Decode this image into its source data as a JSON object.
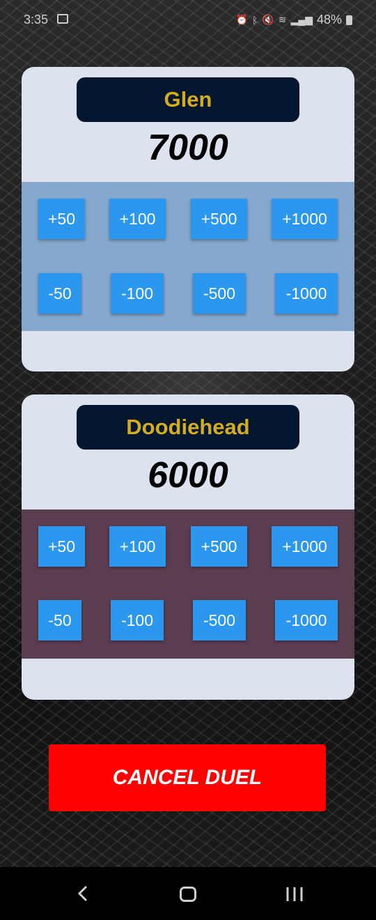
{
  "status_bar": {
    "time": "3:35",
    "battery": "48%",
    "icons": [
      "image-icon",
      "alarm-icon",
      "bluetooth-icon",
      "mute-icon",
      "wifi-icon",
      "volte-icon",
      "signal-icon",
      "battery-icon"
    ]
  },
  "players": [
    {
      "name": "Glen",
      "score": "7000",
      "panel_color": "#86a8cd",
      "add_buttons": [
        "+50",
        "+100",
        "+500",
        "+1000"
      ],
      "subtract_buttons": [
        "-50",
        "-100",
        "-500",
        "-1000"
      ]
    },
    {
      "name": "Doodiehead",
      "score": "6000",
      "panel_color": "#5b3d50",
      "add_buttons": [
        "+50",
        "+100",
        "+500",
        "+1000"
      ],
      "subtract_buttons": [
        "-50",
        "-100",
        "-500",
        "-1000"
      ]
    }
  ],
  "cancel_label": "CANCEL DUEL",
  "colors": {
    "button_blue": "#2b97ef",
    "name_gold": "#d3ac21",
    "name_pill": "#02162f",
    "cancel_red": "#ff0000",
    "card_bg": "#dce3ee"
  },
  "nav_bar": {
    "icons": [
      "back-icon",
      "home-icon",
      "recent-apps-icon"
    ]
  }
}
